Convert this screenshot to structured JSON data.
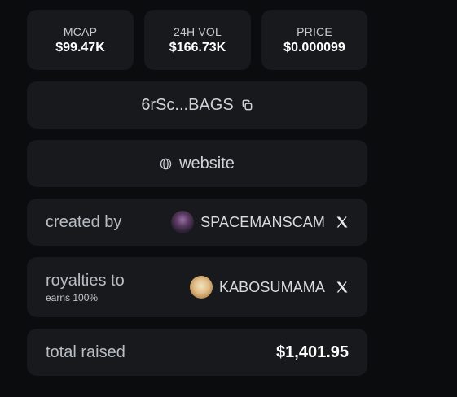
{
  "stats": [
    {
      "label": "MCAP",
      "value": "$99.47K"
    },
    {
      "label": "24H VOL",
      "value": "$166.73K"
    },
    {
      "label": "PRICE",
      "value": "$0.000099"
    }
  ],
  "contract": {
    "address": "6rSc...BAGS",
    "icon": "copy-icon"
  },
  "website": {
    "label": "website",
    "icon": "globe-icon"
  },
  "creator": {
    "label": "created by",
    "name": "SPACEMANSCAM",
    "icon": "x-logo-icon"
  },
  "royalties": {
    "label": "royalties to",
    "sublabel": "earns 100%",
    "name": "KABOSUMAMA",
    "icon": "x-logo-icon"
  },
  "raised": {
    "label": "total raised",
    "value": "$1,401.95"
  },
  "colors": {
    "background": "#0b0c0e",
    "card": "#17191d",
    "text": "#ffffff",
    "muted": "#b8bdc4"
  }
}
